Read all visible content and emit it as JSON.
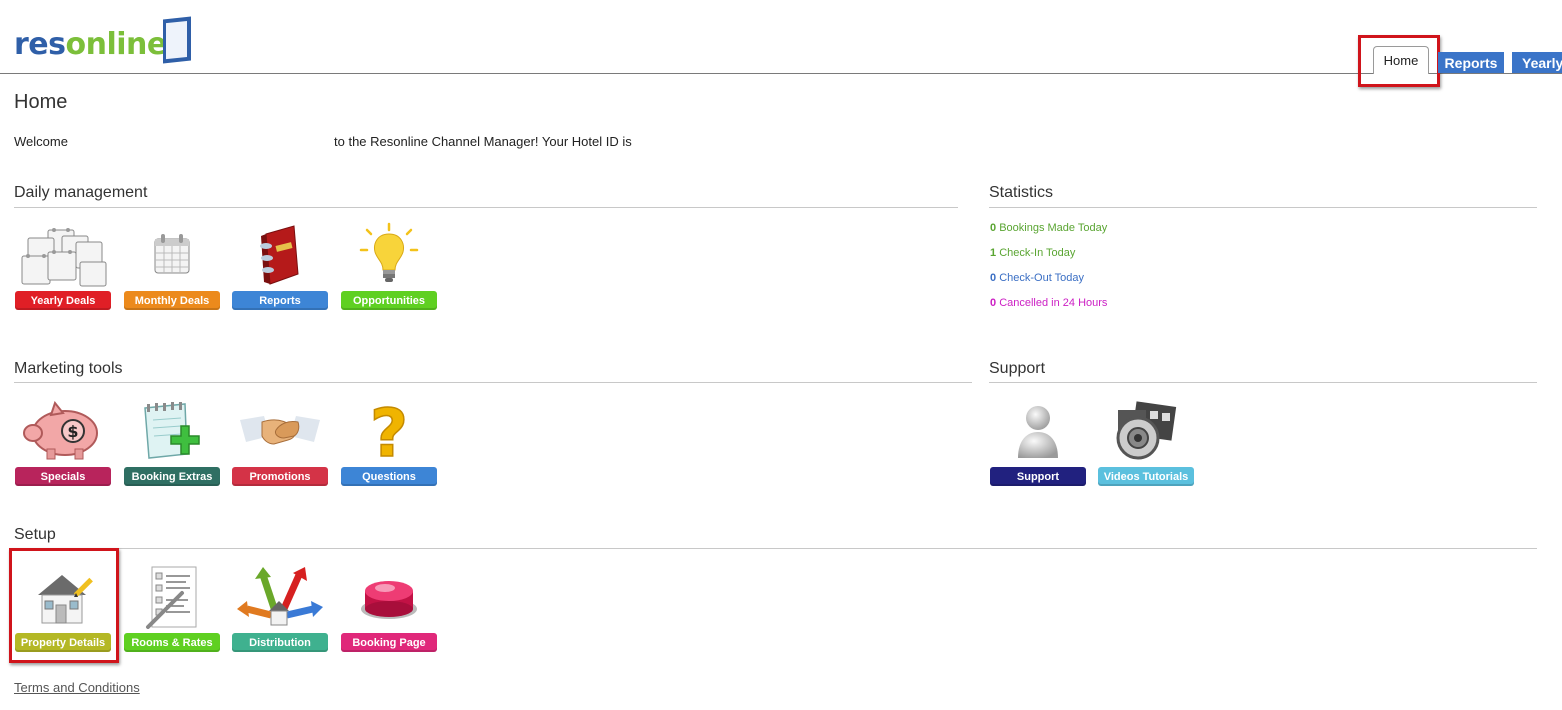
{
  "logo": {
    "part1": "res",
    "part2": "online"
  },
  "tabs": [
    {
      "label": "Home",
      "active": true
    },
    {
      "label": "Reports",
      "active": false
    },
    {
      "label": "Yearly",
      "active": false
    }
  ],
  "page": {
    "title": "Home"
  },
  "welcome": {
    "part1": "Welcome",
    "part2": "to the Resonline Channel Manager! Your Hotel ID is"
  },
  "sections": {
    "daily": {
      "title": "Daily management",
      "tiles": [
        {
          "label": "Yearly Deals",
          "color": "#e01f26",
          "icon": "calendar-multi-icon"
        },
        {
          "label": "Monthly Deals",
          "color": "#ec8a1c",
          "icon": "calendar-icon"
        },
        {
          "label": "Reports",
          "color": "#3d85d6",
          "icon": "binder-book-icon"
        },
        {
          "label": "Opportunities",
          "color": "#5fd021",
          "icon": "lightbulb-icon"
        }
      ]
    },
    "statistics": {
      "title": "Statistics",
      "items": [
        {
          "count": "0",
          "text": "Bookings Made Today",
          "color": "#5aa532"
        },
        {
          "count": "1",
          "text": "Check-In Today",
          "color": "#5aa532"
        },
        {
          "count": "0",
          "text": "Check-Out Today",
          "color": "#3b6fc4"
        },
        {
          "count": "0",
          "text": "Cancelled in 24 Hours",
          "color": "#cc1fc4"
        }
      ]
    },
    "marketing": {
      "title": "Marketing tools",
      "tiles": [
        {
          "label": "Specials",
          "color": "#b8245c",
          "icon": "piggy-bank-icon"
        },
        {
          "label": "Booking Extras",
          "color": "#2f6f63",
          "icon": "notepad-plus-icon"
        },
        {
          "label": "Promotions",
          "color": "#d43347",
          "icon": "handshake-icon"
        },
        {
          "label": "Questions",
          "color": "#3d85d6",
          "icon": "question-mark-icon"
        }
      ]
    },
    "support": {
      "title": "Support",
      "tiles": [
        {
          "label": "Support",
          "color": "#21217f",
          "icon": "user-silhouette-icon"
        },
        {
          "label": "Videos Tutorials",
          "color": "#5bc0de",
          "icon": "film-speaker-icon"
        }
      ]
    },
    "setup": {
      "title": "Setup",
      "tiles": [
        {
          "label": "Property Details",
          "color": "#b4b825",
          "icon": "house-pencil-icon"
        },
        {
          "label": "Rooms & Rates",
          "color": "#5fd021",
          "icon": "checklist-icon"
        },
        {
          "label": "Distribution",
          "color": "#3fb18f",
          "icon": "house-arrows-icon"
        },
        {
          "label": "Booking Page",
          "color": "#e0287a",
          "icon": "red-button-icon"
        }
      ]
    }
  },
  "footer": {
    "terms": "Terms and Conditions"
  }
}
